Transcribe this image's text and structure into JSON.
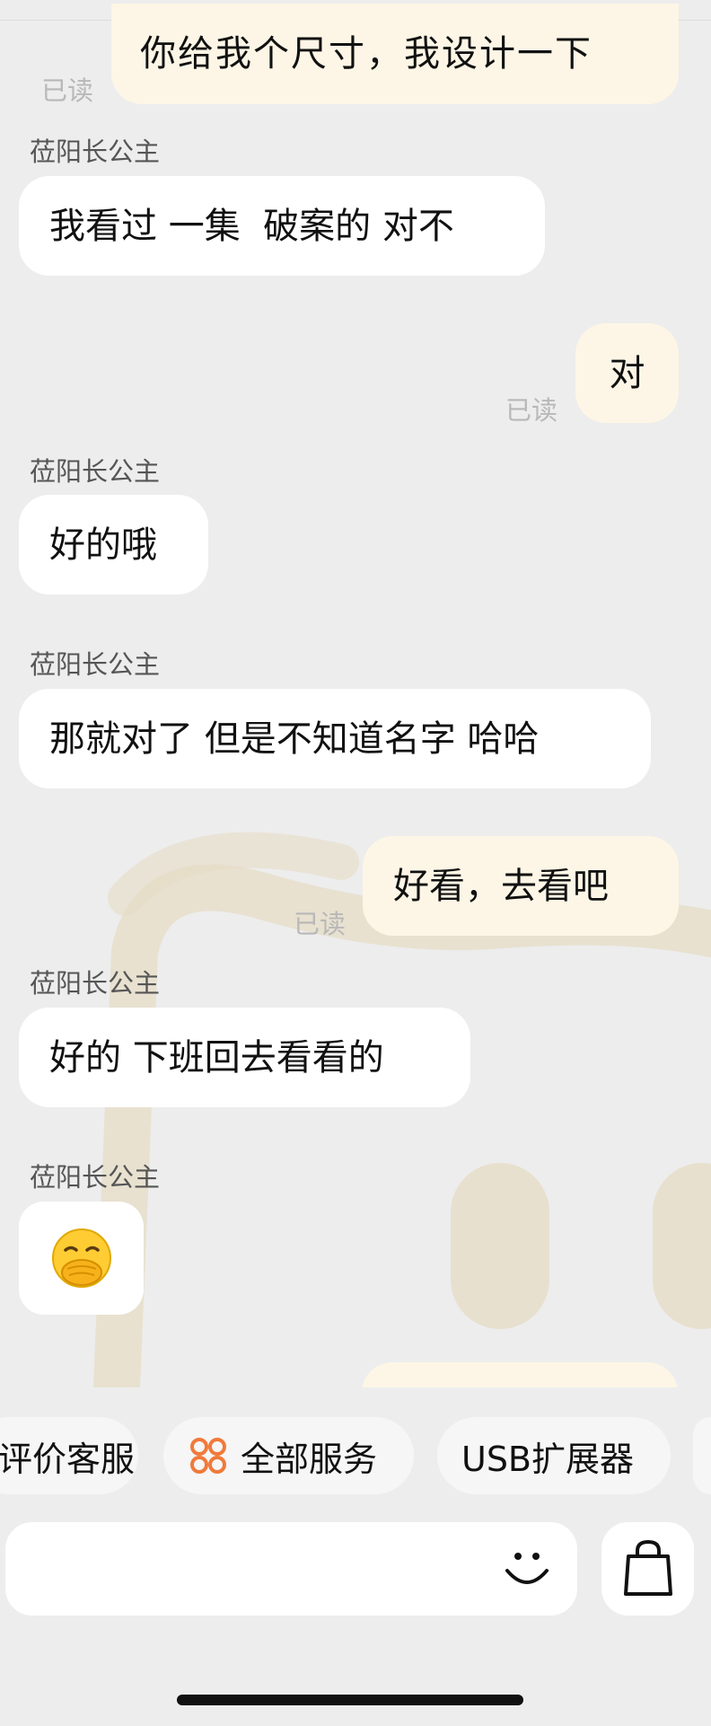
{
  "messages": [
    {
      "id": "m1",
      "direction": "out",
      "text": "你给我个尺寸，我设计一下",
      "read": "已读"
    },
    {
      "id": "m2",
      "direction": "in",
      "sender": "莅阳长公主",
      "text": "我看过 一集  破案的 对不"
    },
    {
      "id": "m3",
      "direction": "out",
      "text": "对",
      "read": "已读"
    },
    {
      "id": "m4",
      "direction": "in",
      "sender": "莅阳长公主",
      "text": "好的哦"
    },
    {
      "id": "m5",
      "direction": "in",
      "sender": "莅阳长公主",
      "text": "那就对了 但是不知道名字 哈哈"
    },
    {
      "id": "m6",
      "direction": "out",
      "text": "好看，去看吧",
      "read": "已读"
    },
    {
      "id": "m7",
      "direction": "in",
      "sender": "莅阳长公主",
      "text": "好的 下班回去看看的"
    },
    {
      "id": "m8",
      "direction": "in",
      "sender": "莅阳长公主",
      "emoji": "face-with-hand-over-mouth"
    }
  ],
  "quick_actions": [
    {
      "label": "评价客服"
    },
    {
      "label": "全部服务",
      "icon": "four-petals-icon"
    },
    {
      "label": "USB扩展器"
    }
  ],
  "input_bar": {
    "emoji_icon": "smiley-icon",
    "bag_icon": "shopping-bag-icon"
  },
  "colors": {
    "background": "#ededed",
    "incoming_bubble": "#ffffff",
    "outgoing_bubble": "#fdf6e6",
    "accent": "#f07a3a",
    "watermark": "#e6dcc6"
  }
}
